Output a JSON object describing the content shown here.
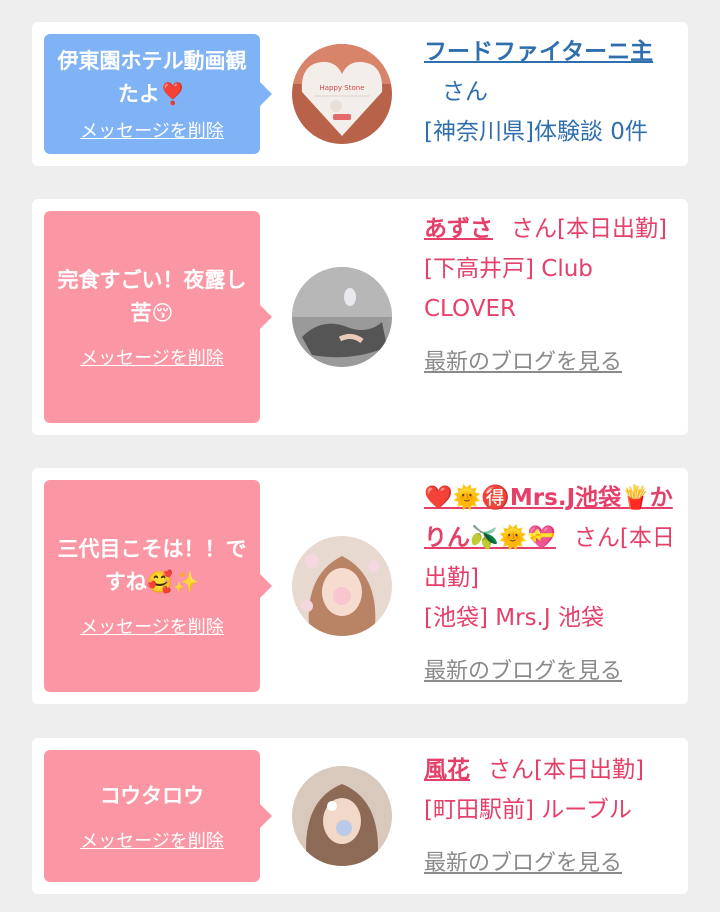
{
  "entries": [
    {
      "message": "伊東園ホテル動画観たよ❣️",
      "delete_label": "メッセージを削除",
      "name": "フードファイターニ主",
      "honorific": "さん",
      "status": "",
      "area": "[神奈川県]",
      "shop": "体験談 0件",
      "blog_link": "",
      "avatar_text": "Happy Stone"
    },
    {
      "message": "完食すごい！夜露し苦😚",
      "delete_label": "メッセージを削除",
      "name": "あずさ",
      "honorific": "さん",
      "status": "[本日出勤]",
      "area": "[下高井戸]",
      "shop": "Club CLOVER",
      "blog_link": "最新のブログを見る"
    },
    {
      "message": "三代目こそは！！ですね🥰✨",
      "delete_label": "メッセージを削除",
      "name": "❤️🌞🉐Mrs.J池袋🍟かりん🫒🌞💝",
      "honorific": "さん",
      "status": "[本日出勤]",
      "area": "[池袋]",
      "shop": "Mrs.J 池袋",
      "blog_link": "最新のブログを見る"
    },
    {
      "message": "コウタロウ",
      "delete_label": "メッセージを削除",
      "name": "風花",
      "honorific": "さん",
      "status": "[本日出勤]",
      "area": "[町田駅前]",
      "shop": "ルーブル",
      "blog_link": "最新のブログを見る"
    }
  ]
}
